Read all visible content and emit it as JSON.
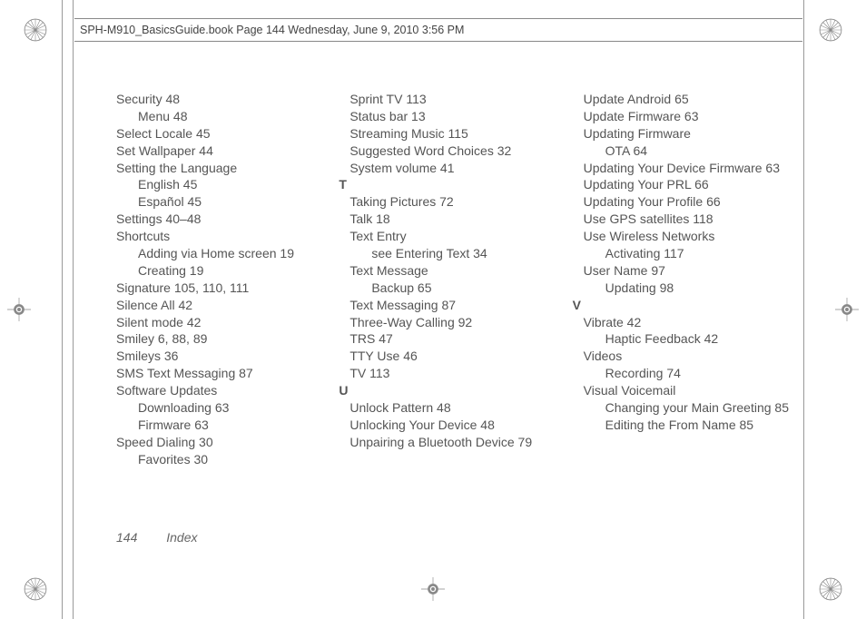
{
  "header": {
    "text": "SPH-M910_BasicsGuide.book  Page 144  Wednesday, June 9, 2010  3:56 PM"
  },
  "footer": {
    "page": "144",
    "label": "Index"
  },
  "columns": {
    "c1": [
      {
        "t": "Security 48"
      },
      {
        "t": "Menu 48",
        "cls": "sub"
      },
      {
        "t": "Select Locale 45"
      },
      {
        "t": "Set Wallpaper 44"
      },
      {
        "t": "Setting the Language"
      },
      {
        "t": "English 45",
        "cls": "sub"
      },
      {
        "t": "Español 45",
        "cls": "sub"
      },
      {
        "t": "Settings 40–48"
      },
      {
        "t": "Shortcuts"
      },
      {
        "t": "Adding via Home screen 19",
        "cls": "sub"
      },
      {
        "t": "Creating 19",
        "cls": "sub"
      },
      {
        "t": "Signature 105, 110, 111"
      },
      {
        "t": "Silence All 42"
      },
      {
        "t": "Silent mode 42"
      },
      {
        "t": "Smiley 6, 88, 89"
      },
      {
        "t": "Smileys 36"
      },
      {
        "t": "SMS Text Messaging 87"
      },
      {
        "t": "Software Updates"
      },
      {
        "t": "Downloading 63",
        "cls": "sub"
      },
      {
        "t": "Firmware 63",
        "cls": "sub"
      },
      {
        "t": "Speed Dialing 30"
      },
      {
        "t": "Favorites 30",
        "cls": "sub"
      }
    ],
    "c2": [
      {
        "t": "Sprint TV 113"
      },
      {
        "t": "Status bar 13"
      },
      {
        "t": "Streaming Music 115"
      },
      {
        "t": "Suggested Word Choices 32"
      },
      {
        "t": "System volume 41"
      },
      {
        "t": "T",
        "cls": "section-letter"
      },
      {
        "t": "Taking Pictures 72"
      },
      {
        "t": "Talk 18"
      },
      {
        "t": "Text Entry"
      },
      {
        "t": "see Entering Text 34",
        "cls": "sub"
      },
      {
        "t": "Text Message"
      },
      {
        "t": "Backup 65",
        "cls": "sub"
      },
      {
        "t": "Text Messaging 87"
      },
      {
        "t": "Three-Way Calling 92"
      },
      {
        "t": "TRS 47"
      },
      {
        "t": "TTY Use 46"
      },
      {
        "t": "TV 113"
      },
      {
        "t": "U",
        "cls": "section-letter"
      },
      {
        "t": "Unlock Pattern 48"
      },
      {
        "t": "Unlocking Your Device 48"
      },
      {
        "t": "Unpairing a Bluetooth Device 79"
      }
    ],
    "c3": [
      {
        "t": "Update Android 65"
      },
      {
        "t": "Update Firmware 63"
      },
      {
        "t": "Updating Firmware"
      },
      {
        "t": "OTA 64",
        "cls": "sub"
      },
      {
        "t": "Updating Your Device Firmware 63"
      },
      {
        "t": "Updating Your PRL 66"
      },
      {
        "t": "Updating Your Profile 66"
      },
      {
        "t": "Use GPS satellites 118"
      },
      {
        "t": "Use Wireless Networks"
      },
      {
        "t": "Activating 117",
        "cls": "sub"
      },
      {
        "t": "User Name 97"
      },
      {
        "t": "Updating 98",
        "cls": "sub"
      },
      {
        "t": "V",
        "cls": "section-letter"
      },
      {
        "t": "Vibrate 42"
      },
      {
        "t": "Haptic Feedback 42",
        "cls": "sub"
      },
      {
        "t": "Videos"
      },
      {
        "t": "Recording 74",
        "cls": "sub"
      },
      {
        "t": "Visual Voicemail"
      },
      {
        "t": "Changing your Main Greeting 85",
        "cls": "sub"
      },
      {
        "t": "Editing the From Name 85",
        "cls": "sub"
      }
    ]
  }
}
